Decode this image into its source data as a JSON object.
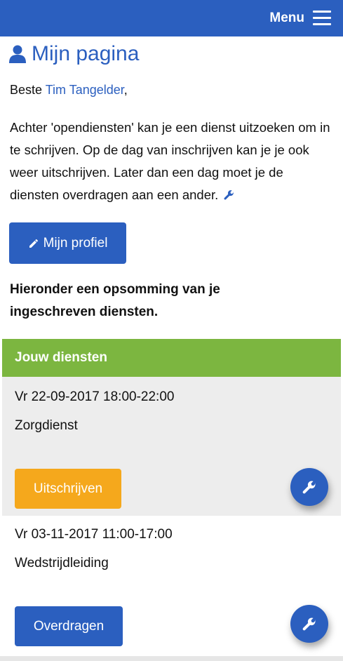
{
  "header": {
    "menu_label": "Menu",
    "menu_icon": "hamburger-icon",
    "accent_color": "#2b5fbf"
  },
  "page": {
    "title": "Mijn pagina",
    "title_icon": "user-icon",
    "greeting_prefix": "Beste ",
    "user_name": "Tim Tangelder",
    "greeting_suffix": ",",
    "intro": "Achter 'opendiensten' kan je een dienst uitzoeken om in te schrijven. Op de dag van inschrijven kan je je ook weer uitschrijven. Later dan een dag moet je de diensten overdragen aan een ander.",
    "profile_button": "Mijn profiel",
    "summary": "Hieronder een opsomming van je ingeschreven diensten."
  },
  "services_panel": {
    "title": "Jouw diensten",
    "header_color": "#7cb640",
    "items": [
      {
        "time": "Vr 22-09-2017 18:00-22:00",
        "name": "Zorgdienst",
        "action": "Uitschrijven",
        "action_color": "#f5a81c"
      },
      {
        "time": "Vr 03-11-2017 11:00-17:00",
        "name": "Wedstrijdleiding",
        "action": "Overdragen",
        "action_color": "#2b5fbf"
      }
    ]
  }
}
